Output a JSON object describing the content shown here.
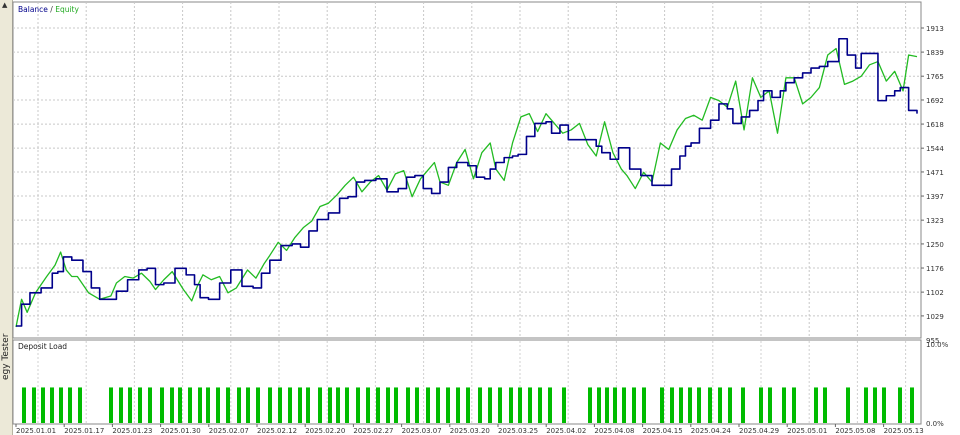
{
  "window": {
    "side_tab_label": "egy Tester",
    "side_tab_arrow": "▲"
  },
  "top_panel": {
    "legend_balance": "Balance",
    "legend_sep": " / ",
    "legend_equity": "Equity",
    "balance_color": "#00008b",
    "equity_color": "#22bb22"
  },
  "bottom_panel": {
    "title": "Deposit Load",
    "y_top_label": "10.0%",
    "y_bottom_label": "0.0%",
    "bar_color": "#00bb00"
  },
  "chart_data": [
    {
      "type": "line",
      "ylim": [
        955,
        1950
      ],
      "y_ticks": [
        "1913",
        "1839",
        "1765",
        "1692",
        "1618",
        "1544",
        "1471",
        "1397",
        "1323",
        "1250",
        "1176",
        "1102",
        "1029",
        "955"
      ],
      "x_ticks": [
        "2025.01.01",
        "2025.01.17",
        "2025.01.23",
        "2025.01.30",
        "2025.02.07",
        "2025.02.12",
        "2025.02.20",
        "2025.02.27",
        "2025.03.07",
        "2025.03.20",
        "2025.03.25",
        "2025.04.02",
        "2025.04.08",
        "2025.04.15",
        "2025.04.24",
        "2025.04.29",
        "2025.05.01",
        "2025.05.08",
        "2025.05.13"
      ],
      "series": [
        {
          "name": "Balance",
          "x": [
            0,
            2,
            5,
            9,
            13,
            15,
            17,
            20,
            24,
            27,
            30,
            34,
            36,
            40,
            44,
            47,
            50,
            53,
            57,
            61,
            64,
            66,
            69,
            73,
            77,
            81,
            85,
            88,
            91,
            95,
            99,
            102,
            105,
            108,
            112,
            116,
            119,
            122,
            125,
            129,
            133,
            137,
            140,
            143,
            146,
            149,
            152,
            155,
            158,
            162,
            165,
            168,
            170,
            172,
            175,
            178,
            180,
            183,
            186,
            190,
            192,
            195,
            198,
            201,
            204,
            208,
            210,
            213,
            216,
            220,
            224,
            228,
            232,
            235,
            238,
            240,
            242,
            245,
            249,
            252,
            255,
            257,
            260,
            263,
            266,
            268,
            271,
            274,
            276,
            279,
            282,
            285,
            288,
            291,
            295,
            298,
            301,
            303,
            306,
            309,
            312,
            315,
            317,
            320,
            323
          ],
          "y": [
            998,
            1065,
            1100,
            1115,
            1160,
            1165,
            1210,
            1200,
            1165,
            1115,
            1080,
            1080,
            1105,
            1140,
            1170,
            1175,
            1125,
            1130,
            1175,
            1155,
            1125,
            1085,
            1080,
            1130,
            1170,
            1120,
            1115,
            1160,
            1200,
            1245,
            1250,
            1240,
            1290,
            1325,
            1345,
            1390,
            1395,
            1440,
            1445,
            1450,
            1410,
            1420,
            1455,
            1460,
            1420,
            1405,
            1440,
            1485,
            1500,
            1490,
            1455,
            1450,
            1480,
            1500,
            1515,
            1520,
            1525,
            1580,
            1620,
            1625,
            1590,
            1615,
            1570,
            1570,
            1570,
            1550,
            1530,
            1510,
            1545,
            1480,
            1460,
            1430,
            1430,
            1480,
            1520,
            1550,
            1560,
            1605,
            1630,
            1680,
            1665,
            1620,
            1640,
            1660,
            1690,
            1720,
            1700,
            1720,
            1745,
            1760,
            1775,
            1790,
            1795,
            1810,
            1880,
            1830,
            1790,
            1835,
            1835,
            1690,
            1705,
            1720,
            1730,
            1660,
            1650
          ]
        },
        {
          "name": "Equity",
          "x": [
            0,
            2,
            4,
            7,
            9,
            11,
            14,
            16,
            18,
            20,
            22,
            26,
            30,
            34,
            36,
            39,
            42,
            45,
            48,
            50,
            53,
            56,
            60,
            63,
            65,
            67,
            70,
            73,
            76,
            79,
            83,
            86,
            89,
            91,
            94,
            97,
            100,
            103,
            106,
            109,
            112,
            115,
            118,
            121,
            124,
            127,
            130,
            133,
            136,
            139,
            142,
            145,
            148,
            150,
            152,
            155,
            158,
            161,
            164,
            167,
            170,
            172,
            175,
            178,
            181,
            184,
            187,
            190,
            193,
            196,
            199,
            202,
            205,
            208,
            211,
            214,
            217,
            219,
            222,
            225,
            228,
            231,
            234,
            237,
            240,
            243,
            246,
            249,
            252,
            255,
            258,
            261,
            264,
            267,
            270,
            273,
            276,
            279,
            282,
            285,
            288,
            291,
            294,
            297,
            300,
            303,
            306,
            309,
            312,
            315,
            318,
            320,
            323
          ],
          "y": [
            995,
            1080,
            1040,
            1100,
            1125,
            1150,
            1185,
            1225,
            1170,
            1150,
            1150,
            1100,
            1080,
            1090,
            1130,
            1150,
            1145,
            1160,
            1135,
            1110,
            1140,
            1165,
            1110,
            1075,
            1120,
            1155,
            1140,
            1150,
            1100,
            1115,
            1170,
            1145,
            1190,
            1215,
            1255,
            1230,
            1270,
            1300,
            1320,
            1365,
            1375,
            1400,
            1430,
            1455,
            1410,
            1440,
            1460,
            1415,
            1465,
            1475,
            1395,
            1450,
            1480,
            1500,
            1440,
            1430,
            1500,
            1540,
            1450,
            1530,
            1560,
            1480,
            1445,
            1560,
            1640,
            1650,
            1595,
            1650,
            1620,
            1590,
            1600,
            1620,
            1555,
            1520,
            1625,
            1530,
            1480,
            1460,
            1420,
            1470,
            1440,
            1560,
            1540,
            1600,
            1635,
            1645,
            1630,
            1700,
            1690,
            1670,
            1750,
            1600,
            1760,
            1700,
            1720,
            1590,
            1760,
            1760,
            1680,
            1700,
            1730,
            1830,
            1850,
            1740,
            1750,
            1765,
            1800,
            1810,
            1750,
            1780,
            1720,
            1830,
            1825
          ]
        }
      ]
    },
    {
      "type": "bar",
      "ylim": [
        0,
        10
      ],
      "y_ticks": [
        "10.0%",
        "0.0%"
      ],
      "bars_x": [
        22,
        32,
        41,
        50,
        59,
        68,
        78,
        109,
        119,
        128,
        138,
        148,
        160,
        170,
        178,
        188,
        198,
        206,
        216,
        226,
        237,
        246,
        256,
        268,
        278,
        288,
        298,
        306,
        318,
        328,
        336,
        345,
        356,
        366,
        376,
        386,
        394,
        406,
        415,
        426,
        436,
        446,
        456,
        466,
        478,
        488,
        498,
        509,
        518,
        528,
        538,
        548,
        562,
        588,
        597,
        605,
        613,
        622,
        632,
        642,
        660,
        670,
        679,
        688,
        697,
        708,
        718,
        728,
        741,
        759,
        768,
        782,
        792,
        814,
        823,
        846,
        864,
        873,
        882,
        898,
        910
      ],
      "bars_y": [
        4.5,
        4.5,
        4.5,
        4.5,
        4.5,
        4.5,
        4.5,
        4.5,
        4.5,
        4.5,
        4.5,
        4.5,
        4.5,
        4.5,
        4.5,
        4.5,
        4.5,
        4.5,
        4.5,
        4.5,
        4.5,
        4.5,
        4.5,
        4.5,
        4.5,
        4.5,
        4.5,
        4.5,
        4.5,
        4.5,
        4.5,
        4.5,
        4.5,
        4.5,
        4.5,
        4.5,
        4.5,
        4.5,
        4.5,
        4.5,
        4.5,
        4.5,
        4.5,
        4.5,
        4.5,
        4.5,
        4.5,
        4.5,
        4.5,
        4.5,
        4.5,
        4.5,
        4.5,
        4.5,
        4.5,
        4.5,
        4.5,
        4.5,
        4.5,
        4.5,
        4.5,
        4.5,
        4.5,
        4.5,
        4.5,
        4.5,
        4.5,
        4.5,
        4.5,
        4.5,
        4.5,
        4.5,
        4.5,
        4.5,
        4.5,
        4.5,
        4.5,
        4.5,
        4.5,
        4.5,
        4.5
      ]
    }
  ]
}
